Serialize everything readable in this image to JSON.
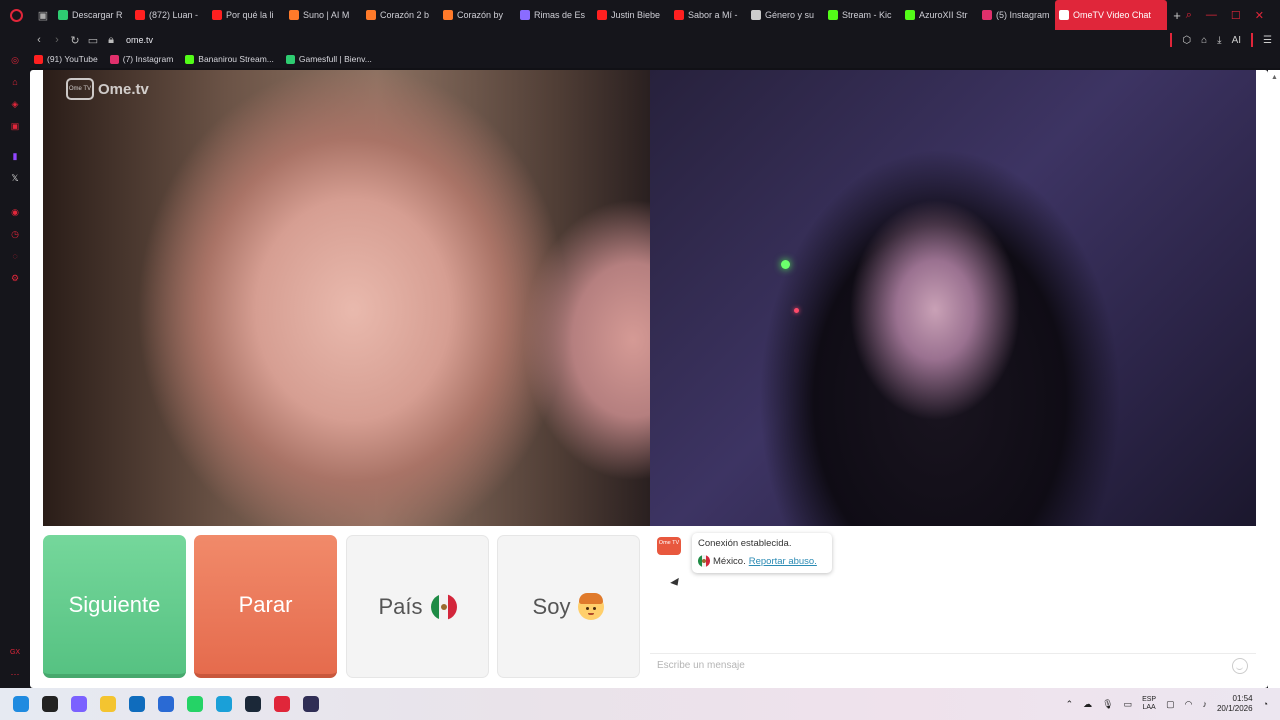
{
  "browser": {
    "tabs": [
      {
        "label": "Descargar R",
        "color": "#2ecc71"
      },
      {
        "label": "(872) Luan -",
        "color": "#ff2020"
      },
      {
        "label": "Por qué la li",
        "color": "#ff2020"
      },
      {
        "label": "Suno | AI M",
        "color": "#ff7a2a"
      },
      {
        "label": "Corazón 2 b",
        "color": "#ff7a2a"
      },
      {
        "label": "Corazón by",
        "color": "#ff7a2a"
      },
      {
        "label": "Rimas de Es",
        "color": "#8a6cff"
      },
      {
        "label": "Justin Biebe",
        "color": "#ff2020"
      },
      {
        "label": "Sabor a Mí -",
        "color": "#ff2020"
      },
      {
        "label": "Género y su",
        "color": "#cccccc"
      },
      {
        "label": "Stream - Kic",
        "color": "#53fc18"
      },
      {
        "label": "AzuroXII Str",
        "color": "#53fc18"
      },
      {
        "label": "(5) Instagram",
        "color": "#e1306c"
      }
    ],
    "active_tab": {
      "label": "OmeTV Video Chat",
      "color": "#ffffff"
    },
    "url": "ome.tv",
    "bookmarks": [
      {
        "label": "(91) YouTube",
        "color": "#ff2020"
      },
      {
        "label": "(7) Instagram",
        "color": "#e1306c"
      },
      {
        "label": "Bananirou Stream...",
        "color": "#53fc18"
      },
      {
        "label": "Gamesfull | Bienv...",
        "color": "#2ecc71"
      }
    ],
    "addr_right_ai": "AI"
  },
  "page": {
    "watermark": {
      "logo_text": "Ome TV",
      "brand": "Ome.tv"
    },
    "buttons": {
      "next": "Siguiente",
      "stop": "Parar",
      "country": "País",
      "gender": "Soy"
    },
    "chat": {
      "logo_text": "Ome TV",
      "status": "Conexión establecida.",
      "country": "México.",
      "report": "Reportar abuso.",
      "input_placeholder": "Escribe un mensaje"
    }
  },
  "taskbar": {
    "apps": [
      {
        "name": "windows-start-icon",
        "color": "#1f8be0"
      },
      {
        "name": "search-icon",
        "color": "#222222"
      },
      {
        "name": "copilot-icon",
        "color": "#7b61ff"
      },
      {
        "name": "file-explorer-icon",
        "color": "#f4c430"
      },
      {
        "name": "outlook-icon",
        "color": "#0f6cbd"
      },
      {
        "name": "store-icon",
        "color": "#2a6ad4"
      },
      {
        "name": "whatsapp-icon",
        "color": "#25d366"
      },
      {
        "name": "edge-icon",
        "color": "#1aa0d8"
      },
      {
        "name": "steam-icon",
        "color": "#1b2838"
      },
      {
        "name": "opera-icon",
        "color": "#e0263a"
      },
      {
        "name": "obs-icon",
        "color": "#302e55"
      }
    ],
    "lang_top": "ESP",
    "lang_bottom": "LAA",
    "time": "01:54",
    "date": "20/1/2026"
  }
}
